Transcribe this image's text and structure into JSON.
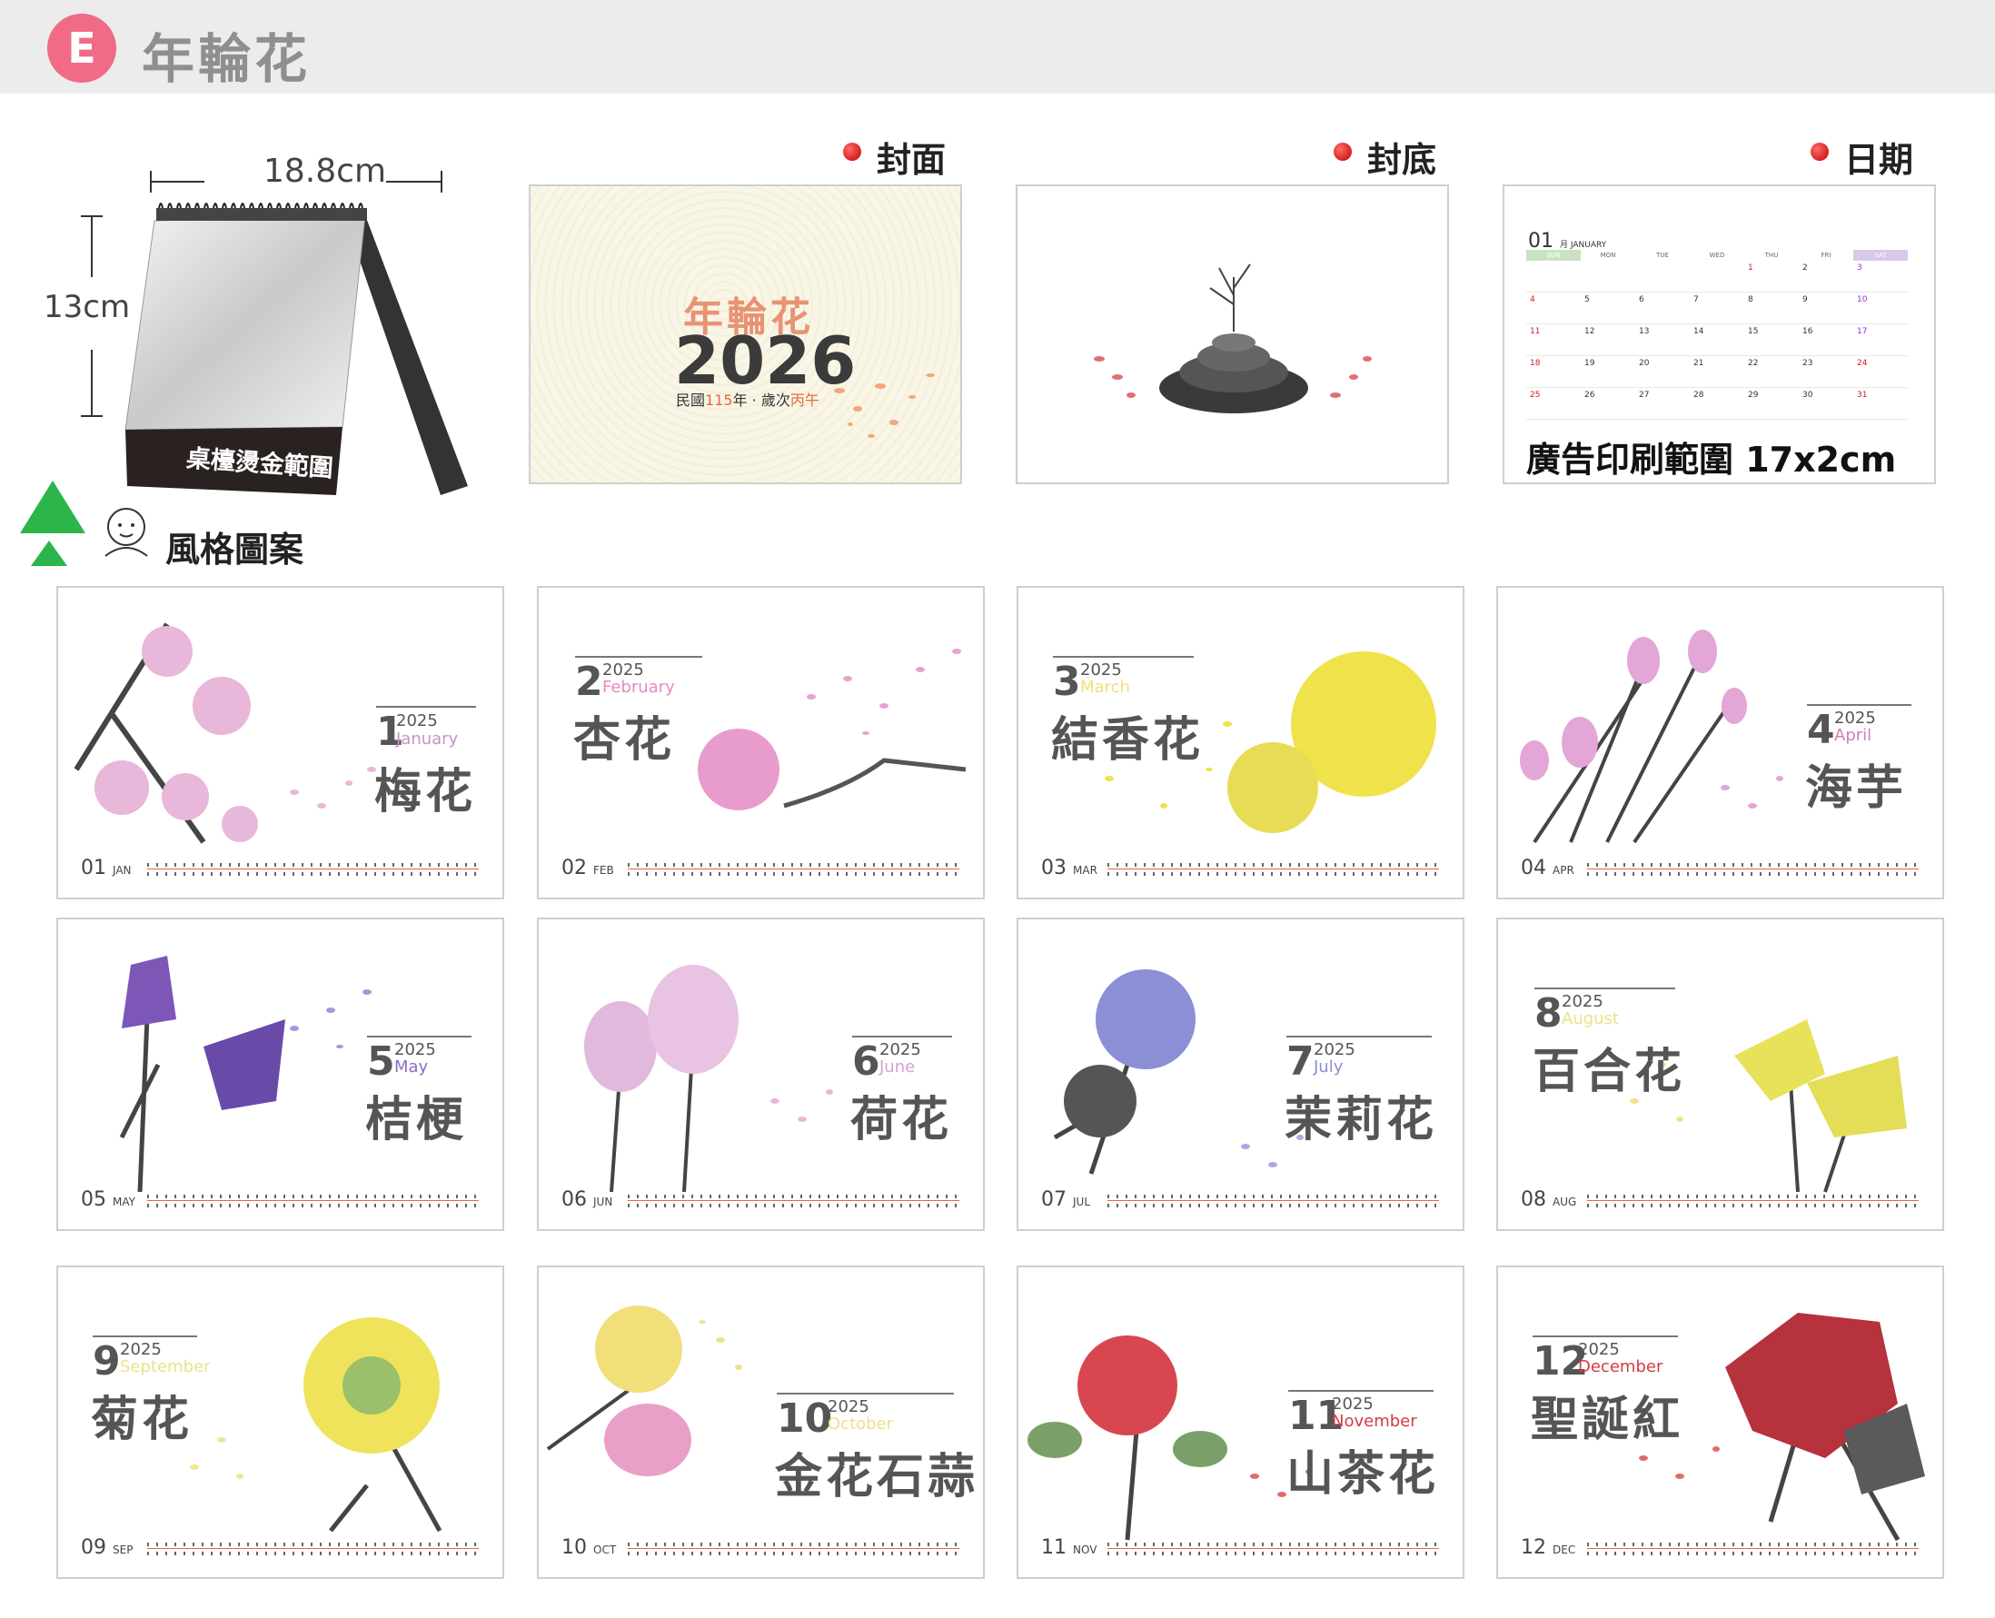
{
  "header": {
    "badge": "E",
    "title": "年輪花"
  },
  "mockup": {
    "width_label": "18.8cm",
    "height_label": "13cm",
    "base_label": "桌檯燙金範圍"
  },
  "sections": {
    "cover": "封面",
    "back": "封底",
    "date": "日期"
  },
  "cover": {
    "title": "年輪花",
    "year": "2026",
    "sub_prefix": "民國",
    "sub_roc": "115",
    "sub_mid": "年 · 歲次",
    "sub_zodiac": "丙午"
  },
  "date_preview": {
    "month_num": "01",
    "month_en": "月 JANUARY",
    "weekdays": [
      "SUN",
      "MON",
      "TUE",
      "WED",
      "THU",
      "FRI",
      "SAT"
    ],
    "weeks": [
      [
        "",
        "",
        "",
        "",
        "1",
        "2",
        "3"
      ],
      [
        "4",
        "5",
        "6",
        "7",
        "8",
        "9",
        "10"
      ],
      [
        "11",
        "12",
        "13",
        "14",
        "15",
        "16",
        "17"
      ],
      [
        "18",
        "19",
        "20",
        "21",
        "22",
        "23",
        "24"
      ],
      [
        "25",
        "26",
        "27",
        "28",
        "29",
        "30",
        "31"
      ]
    ],
    "ad_label": "廣告印刷範圍 17x2cm"
  },
  "style_label": "風格圖案",
  "colors": {
    "accent_pink": "#f06b86",
    "header_bg": "#ececec",
    "text_gray": "#8f8f8f",
    "cover_orange": "#e79374"
  },
  "months": [
    {
      "num": "1",
      "year": "2025",
      "eng": "January",
      "flower": "梅花",
      "foot_num": "01",
      "foot_abbr": "JAN",
      "eng_color": "#c892c8"
    },
    {
      "num": "2",
      "year": "2025",
      "eng": "February",
      "flower": "杏花",
      "foot_num": "02",
      "foot_abbr": "FEB",
      "eng_color": "#e58bbf"
    },
    {
      "num": "3",
      "year": "2025",
      "eng": "March",
      "flower": "結香花",
      "foot_num": "03",
      "foot_abbr": "MAR",
      "eng_color": "#efe07a"
    },
    {
      "num": "4",
      "year": "2025",
      "eng": "April",
      "flower": "海芋",
      "foot_num": "04",
      "foot_abbr": "APR",
      "eng_color": "#d27cc0"
    },
    {
      "num": "5",
      "year": "2025",
      "eng": "May",
      "flower": "桔梗",
      "foot_num": "05",
      "foot_abbr": "MAY",
      "eng_color": "#8d6cc7"
    },
    {
      "num": "6",
      "year": "2025",
      "eng": "June",
      "flower": "荷花",
      "foot_num": "06",
      "foot_abbr": "JUN",
      "eng_color": "#d99ed4"
    },
    {
      "num": "7",
      "year": "2025",
      "eng": "July",
      "flower": "茉莉花",
      "foot_num": "07",
      "foot_abbr": "JUL",
      "eng_color": "#8b8bd6"
    },
    {
      "num": "8",
      "year": "2025",
      "eng": "August",
      "flower": "百合花",
      "foot_num": "08",
      "foot_abbr": "AUG",
      "eng_color": "#e7e28d"
    },
    {
      "num": "9",
      "year": "2025",
      "eng": "September",
      "flower": "菊花",
      "foot_num": "09",
      "foot_abbr": "SEP",
      "eng_color": "#e9e38a"
    },
    {
      "num": "10",
      "year": "2025",
      "eng": "October",
      "flower": "金花石蒜",
      "foot_num": "10",
      "foot_abbr": "OCT",
      "eng_color": "#ede08a"
    },
    {
      "num": "11",
      "year": "2025",
      "eng": "November",
      "flower": "山茶花",
      "foot_num": "11",
      "foot_abbr": "NOV",
      "eng_color": "#d33a44"
    },
    {
      "num": "12",
      "year": "2025",
      "eng": "December",
      "flower": "聖誕紅",
      "foot_num": "12",
      "foot_abbr": "DEC",
      "eng_color": "#d33a44"
    }
  ]
}
